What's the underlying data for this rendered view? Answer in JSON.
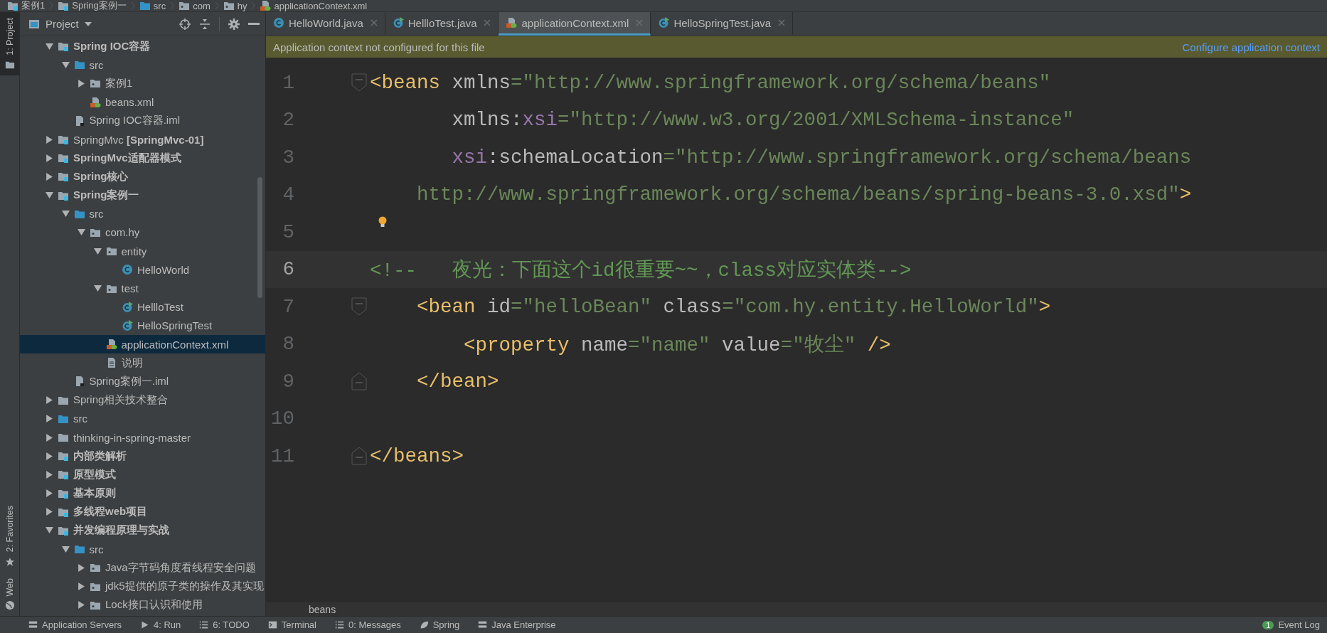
{
  "breadcrumb": [
    {
      "label": "案例1",
      "kind": "module"
    },
    {
      "label": "Spring案例一",
      "kind": "module"
    },
    {
      "label": "src",
      "kind": "src"
    },
    {
      "label": "com",
      "kind": "package"
    },
    {
      "label": "hy",
      "kind": "package"
    },
    {
      "label": "applicationContext.xml",
      "kind": "xml"
    }
  ],
  "tool_strip": {
    "top": [
      {
        "label": "1: Project",
        "kind": "folder",
        "selected": true
      }
    ],
    "bottom": [
      {
        "label": "2: Favorites",
        "kind": "star",
        "selected": false
      },
      {
        "label": "Web",
        "kind": "globe",
        "selected": false
      }
    ]
  },
  "project_panel": {
    "title": "Project",
    "tree": [
      {
        "label": "Spring IOC容器",
        "kind": "module",
        "bold": true,
        "selected": false,
        "expanded": true,
        "children": [
          {
            "label": "src",
            "kind": "src",
            "bold": false,
            "selected": false,
            "expanded": true,
            "children": [
              {
                "label": "案例1",
                "kind": "package",
                "bold": false,
                "selected": false,
                "expanded": false
              },
              {
                "label": "beans.xml",
                "kind": "xml",
                "bold": false,
                "selected": false
              }
            ]
          },
          {
            "label": "Spring IOC容器.iml",
            "kind": "iml",
            "bold": false,
            "selected": false
          }
        ]
      },
      {
        "label": "SpringMvc **[SpringMvc-01]**",
        "kind": "module",
        "bold": false,
        "selected": false,
        "expanded": false
      },
      {
        "label": "SpringMvc适配器模式",
        "kind": "module",
        "bold": true,
        "selected": false,
        "expanded": false
      },
      {
        "label": "Spring核心",
        "kind": "module",
        "bold": true,
        "selected": false,
        "expanded": false
      },
      {
        "label": "Spring案例一",
        "kind": "module",
        "bold": true,
        "selected": false,
        "expanded": true,
        "children": [
          {
            "label": "src",
            "kind": "src",
            "bold": false,
            "selected": false,
            "expanded": true,
            "children": [
              {
                "label": "com.hy",
                "kind": "package",
                "bold": false,
                "selected": false,
                "expanded": true,
                "children": [
                  {
                    "label": "entity",
                    "kind": "package",
                    "bold": false,
                    "selected": false,
                    "expanded": true,
                    "children": [
                      {
                        "label": "HelloWorld",
                        "kind": "class",
                        "bold": false,
                        "selected": false
                      }
                    ]
                  },
                  {
                    "label": "test",
                    "kind": "package",
                    "bold": false,
                    "selected": false,
                    "expanded": true,
                    "children": [
                      {
                        "label": "HellloTest",
                        "kind": "test",
                        "bold": false,
                        "selected": false
                      },
                      {
                        "label": "HelloSpringTest",
                        "kind": "test",
                        "bold": false,
                        "selected": false
                      }
                    ]
                  },
                  {
                    "label": "applicationContext.xml",
                    "kind": "xml",
                    "bold": false,
                    "selected": true
                  },
                  {
                    "label": "说明",
                    "kind": "text",
                    "bold": false,
                    "selected": false
                  }
                ]
              }
            ]
          },
          {
            "label": "Spring案例一.iml",
            "kind": "iml",
            "bold": false,
            "selected": false
          }
        ]
      },
      {
        "label": "Spring相关技术整合",
        "kind": "folder",
        "bold": false,
        "selected": false,
        "expanded": false
      },
      {
        "label": "src",
        "kind": "src",
        "bold": false,
        "selected": false,
        "expanded": false
      },
      {
        "label": "thinking-in-spring-master",
        "kind": "folder",
        "bold": false,
        "selected": false,
        "expanded": false
      },
      {
        "label": "内部类解析",
        "kind": "module",
        "bold": true,
        "selected": false,
        "expanded": false
      },
      {
        "label": "原型模式",
        "kind": "module",
        "bold": true,
        "selected": false,
        "expanded": false
      },
      {
        "label": "基本原则",
        "kind": "module",
        "bold": true,
        "selected": false,
        "expanded": false
      },
      {
        "label": "多线程web项目",
        "kind": "module",
        "bold": true,
        "selected": false,
        "expanded": false
      },
      {
        "label": "并发编程原理与实战",
        "kind": "module",
        "bold": true,
        "selected": false,
        "expanded": true,
        "children": [
          {
            "label": "src",
            "kind": "src",
            "bold": false,
            "selected": false,
            "expanded": true,
            "children": [
              {
                "label": "Java字节码角度看线程安全问题",
                "kind": "package",
                "bold": false,
                "selected": false,
                "expanded": false
              },
              {
                "label": "jdk5提供的原子类的操作及其实现",
                "kind": "package",
                "bold": false,
                "selected": false,
                "expanded": false
              },
              {
                "label": "Lock接口认识和使用",
                "kind": "package",
                "bold": false,
                "selected": false,
                "expanded": false
              }
            ]
          }
        ]
      }
    ]
  },
  "editor": {
    "tabs": [
      {
        "label": "HelloWorld.java",
        "kind": "class",
        "selected": false
      },
      {
        "label": "HellloTest.java",
        "kind": "test",
        "selected": false
      },
      {
        "label": "applicationContext.xml",
        "kind": "xml",
        "selected": true
      },
      {
        "label": "HelloSpringTest.java",
        "kind": "test",
        "selected": false
      }
    ],
    "banner": {
      "message": "Application context not configured for this file",
      "link": "Configure application context"
    },
    "lines": [
      {
        "number": "1",
        "kind": "opener",
        "current": false,
        "tokens": [
          {
            "kind": "tag",
            "text": "<beans"
          },
          {
            "kind": "attr",
            "text": " xmlns"
          },
          {
            "kind": "value",
            "text": "=\"http://www.springframework.org/schema/beans\""
          }
        ]
      },
      {
        "number": "2",
        "kind": "plain",
        "current": false,
        "tokens": [
          {
            "kind": "attr",
            "text": "       xmlns:"
          },
          {
            "kind": "ns",
            "text": "xsi"
          },
          {
            "kind": "value",
            "text": "=\"http://www.w3.org/2001/XMLSchema-instance\""
          }
        ]
      },
      {
        "number": "3",
        "kind": "plain",
        "current": false,
        "tokens": [
          {
            "kind": "ns",
            "text": "       xsi"
          },
          {
            "kind": "attr",
            "text": ":schemaLocation"
          },
          {
            "kind": "value",
            "text": "=\"http://www.springframework.org/schema/beans"
          }
        ]
      },
      {
        "number": "4",
        "kind": "plain",
        "current": false,
        "tokens": [
          {
            "kind": "value",
            "text": "    http://www.springframework.org/schema/beans/spring-beans-3.0.xsd\""
          },
          {
            "kind": "tag",
            "text": ">"
          }
        ]
      },
      {
        "number": "5",
        "kind": "plain",
        "current": false,
        "bulb": true
      },
      {
        "number": "6",
        "kind": "plain",
        "current": true,
        "tokens": [
          {
            "kind": "comment",
            "text": "<!--   夜光：下面这个id很重要~~，class对应实体类-->"
          }
        ]
      },
      {
        "number": "7",
        "kind": "opener",
        "current": false,
        "tokens": [
          {
            "kind": "tag",
            "text": "    <bean"
          },
          {
            "kind": "attr",
            "text": " id"
          },
          {
            "kind": "value",
            "text": "=\"helloBean\""
          },
          {
            "kind": "attr",
            "text": " class"
          },
          {
            "kind": "value",
            "text": "=\"com.hy.entity.HelloWorld\""
          },
          {
            "kind": "tag",
            "text": ">"
          }
        ]
      },
      {
        "number": "8",
        "kind": "plain",
        "current": false,
        "tokens": [
          {
            "kind": "tag",
            "text": "        <property"
          },
          {
            "kind": "attr",
            "text": " name"
          },
          {
            "kind": "value",
            "text": "=\"name\""
          },
          {
            "kind": "attr",
            "text": " value"
          },
          {
            "kind": "value",
            "text": "=\"牧尘\""
          },
          {
            "kind": "tag",
            "text": " />"
          }
        ]
      },
      {
        "number": "9",
        "kind": "closer",
        "current": false,
        "tokens": [
          {
            "kind": "tag",
            "text": "    </bean>"
          }
        ]
      },
      {
        "number": "10",
        "kind": "plain",
        "current": false
      },
      {
        "number": "11",
        "kind": "closer",
        "current": false,
        "tokens": [
          {
            "kind": "tag",
            "text": "</beans>"
          }
        ]
      }
    ],
    "breadcrumb": "beans"
  },
  "bottom_toolbar": [
    {
      "label": "Application Servers",
      "kind": "servers"
    },
    {
      "label": "4: Run",
      "kind": "run"
    },
    {
      "label": "6: TODO",
      "kind": "list"
    },
    {
      "label": "Terminal",
      "kind": "terminal"
    },
    {
      "label": "0: Messages",
      "kind": "list"
    },
    {
      "label": "Spring",
      "kind": "leaf"
    },
    {
      "label": "Java Enterprise",
      "kind": "servers"
    },
    {
      "label": "Event Log",
      "badge": "1"
    }
  ]
}
